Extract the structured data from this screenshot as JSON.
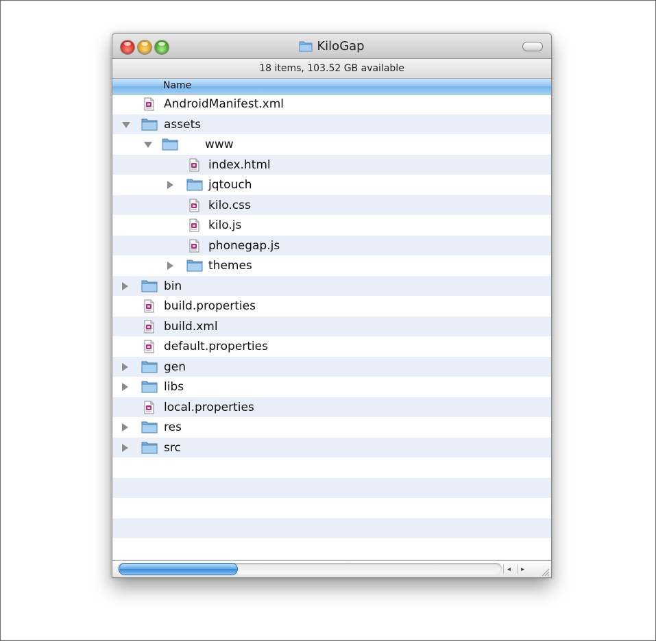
{
  "window": {
    "title": "KiloGap",
    "status": "18 items, 103.52 GB available",
    "column_header": "Name"
  },
  "items": [
    {
      "name": "AndroidManifest.xml",
      "type": "file",
      "level": 0,
      "disclosure": "none"
    },
    {
      "name": "assets",
      "type": "folder",
      "level": 0,
      "disclosure": "expanded"
    },
    {
      "name": "www",
      "type": "folder",
      "level": 1,
      "disclosure": "expanded"
    },
    {
      "name": "index.html",
      "type": "file",
      "level": 2,
      "disclosure": "none"
    },
    {
      "name": "jqtouch",
      "type": "folder",
      "level": 2,
      "disclosure": "collapsed"
    },
    {
      "name": "kilo.css",
      "type": "file",
      "level": 2,
      "disclosure": "none"
    },
    {
      "name": "kilo.js",
      "type": "file",
      "level": 2,
      "disclosure": "none"
    },
    {
      "name": "phonegap.js",
      "type": "file",
      "level": 2,
      "disclosure": "none"
    },
    {
      "name": "themes",
      "type": "folder",
      "level": 2,
      "disclosure": "collapsed"
    },
    {
      "name": "bin",
      "type": "folder",
      "level": 0,
      "disclosure": "collapsed"
    },
    {
      "name": "build.properties",
      "type": "file",
      "level": 0,
      "disclosure": "none"
    },
    {
      "name": "build.xml",
      "type": "file",
      "level": 0,
      "disclosure": "none"
    },
    {
      "name": "default.properties",
      "type": "file",
      "level": 0,
      "disclosure": "none"
    },
    {
      "name": "gen",
      "type": "folder",
      "level": 0,
      "disclosure": "collapsed"
    },
    {
      "name": "libs",
      "type": "folder",
      "level": 0,
      "disclosure": "collapsed"
    },
    {
      "name": "local.properties",
      "type": "file",
      "level": 0,
      "disclosure": "none"
    },
    {
      "name": "res",
      "type": "folder",
      "level": 0,
      "disclosure": "collapsed"
    },
    {
      "name": "src",
      "type": "folder",
      "level": 0,
      "disclosure": "collapsed"
    }
  ],
  "scrollbar": {
    "left_arrow": "◂",
    "right_arrow": "▸"
  },
  "colors": {
    "alt_row": "#e9eff9",
    "folder": "#8fbde6",
    "header": "#8ec4f2"
  }
}
